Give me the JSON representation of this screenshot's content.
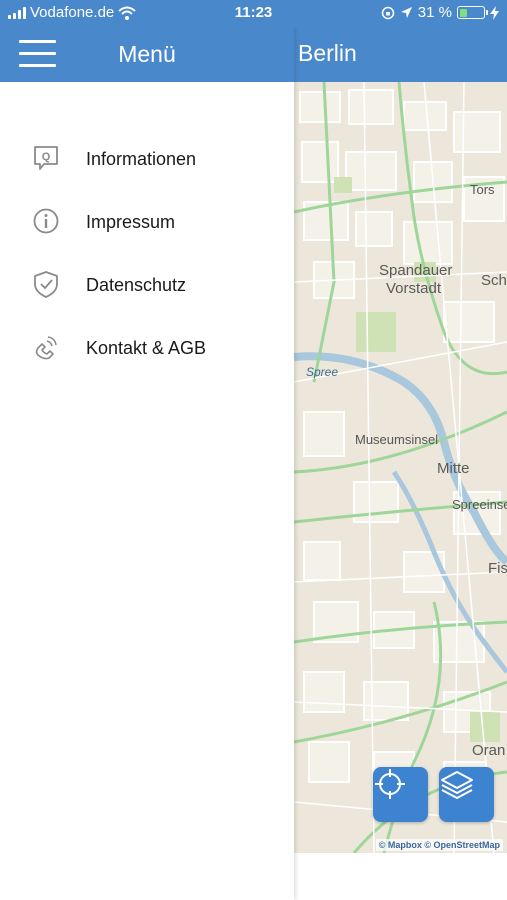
{
  "status_bar": {
    "carrier": "Vodafone.de",
    "time": "11:23",
    "battery_percent": "31 %",
    "battery_level": 0.31
  },
  "drawer": {
    "title": "Menü",
    "menu_items": [
      {
        "label": "Informationen",
        "icon": "info-bubble-icon"
      },
      {
        "label": "Impressum",
        "icon": "info-circle-icon"
      },
      {
        "label": "Datenschutz",
        "icon": "shield-check-icon"
      },
      {
        "label": "Kontakt & AGB",
        "icon": "phone-icon"
      }
    ]
  },
  "map": {
    "title": "Berlin",
    "labels": {
      "tors": "Tors",
      "spandauer_1": "Spandauer",
      "spandauer_2": "Vorstadt",
      "sch": "Sch",
      "spree": "Spree",
      "museumsinsel": "Museumsinsel",
      "mitte": "Mitte",
      "spreeinsel": "Spreeinse",
      "fis": "Fis",
      "oran": "Oran"
    },
    "attribution": "© Mapbox © OpenStreetMap",
    "buttons": {
      "locate": "crosshair-icon",
      "layers": "layers-icon"
    }
  },
  "colors": {
    "header_blue": "#4a88cc",
    "button_blue": "#3d83cf",
    "map_bg": "#ece7da",
    "road_green": "#9ed69a",
    "river": "#a9c7dd"
  }
}
